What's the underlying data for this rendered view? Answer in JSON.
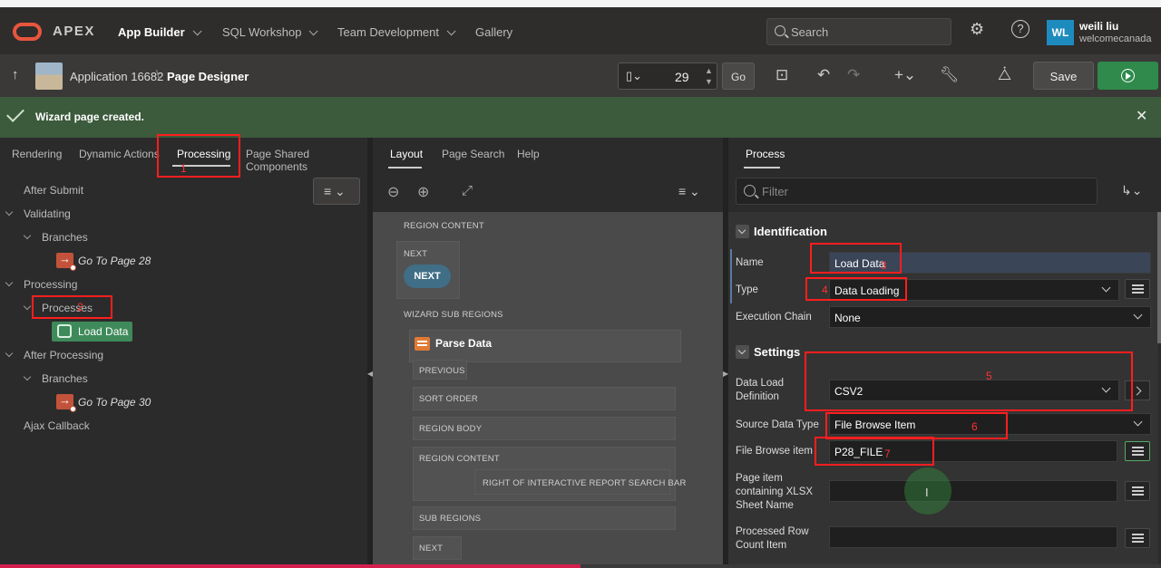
{
  "nav": {
    "brand": "APEX",
    "links": [
      "App Builder",
      "SQL Workshop",
      "Team Development",
      "Gallery"
    ],
    "search_placeholder": "Search",
    "user_initials": "WL",
    "user_name": "weili liu",
    "user_org": "welcomecanada"
  },
  "toolbar": {
    "app_label": "Application 16682",
    "separator": "\\",
    "page_title": "Page Designer",
    "page_number": "29",
    "go_label": "Go",
    "save_label": "Save"
  },
  "alert": {
    "message": "Wizard page created."
  },
  "left": {
    "tabs": [
      "Rendering",
      "Dynamic Actions",
      "Processing",
      "Page Shared Components"
    ],
    "tree": {
      "after_submit": "After Submit",
      "validating": "Validating",
      "branches1": "Branches",
      "go28": "Go To Page 28",
      "processing": "Processing",
      "processes": "Processes",
      "load_data": "Load Data",
      "after_processing": "After Processing",
      "branches2": "Branches",
      "go30": "Go To Page 30",
      "ajax": "Ajax Callback"
    }
  },
  "middle": {
    "tabs": [
      "Layout",
      "Page Search",
      "Help"
    ],
    "regions": {
      "region_content": "REGION CONTENT",
      "next_label": "NEXT",
      "next_button": "NEXT",
      "wizard_sub": "WIZARD SUB REGIONS",
      "parse": "Parse Data",
      "previous": "PREVIOUS",
      "sort_order": "SORT ORDER",
      "region_body": "REGION BODY",
      "region_content2": "REGION CONTENT",
      "right_of_ir": "RIGHT OF INTERACTIVE REPORT SEARCH BAR",
      "sub_regions": "SUB REGIONS",
      "next2": "NEXT"
    }
  },
  "right": {
    "tab": "Process",
    "filter_placeholder": "Filter",
    "identification": "Identification",
    "settings": "Settings",
    "fields": {
      "name_label": "Name",
      "name_value": "Load Data",
      "type_label": "Type",
      "type_value": "Data Loading",
      "exec_label": "Execution Chain",
      "exec_value": "None",
      "dld_label": "Data Load Definition",
      "dld_value": "CSV2",
      "sdt_label": "Source Data Type",
      "sdt_value": "File Browse Item",
      "fbi_label": "File Browse item",
      "fbi_value": "P28_FILE",
      "xlsx_label": "Page item containing XLSX Sheet Name",
      "prc_label": "Processed Row Count Item"
    }
  },
  "annotations": [
    "1",
    "2",
    "3",
    "4",
    "5",
    "6",
    "7"
  ]
}
